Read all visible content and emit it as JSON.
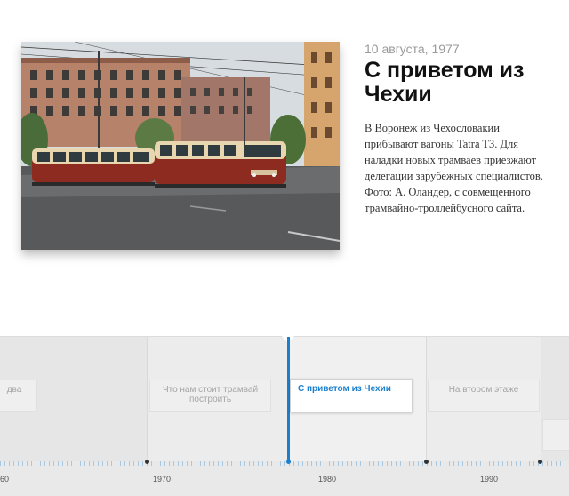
{
  "event": {
    "date": "10 августа, 1977",
    "title": "С приветом из Чехии",
    "description": "В Воронеж из Чехословакии прибывают вагоны Tatra T3. Для наладки новых трамваев приезжают делегации зарубежных специалистов. Фото: А. Оландер, с совмещенного трамвайно-троллейбусного сайта."
  },
  "timeline": {
    "events": [
      {
        "label": "два"
      },
      {
        "label": "Что нам стоит трамвай построить"
      },
      {
        "label": "С приветом из Чехии"
      },
      {
        "label": "На втором этаже"
      },
      {
        "label": ""
      }
    ],
    "years": [
      "60",
      "1970",
      "1980",
      "1990"
    ]
  },
  "colors": {
    "accent": "#1b7fcf",
    "timeline_bg": "#e9e9e9",
    "tram_red": "#8e2b20",
    "tram_cream": "#e8d6b0"
  }
}
